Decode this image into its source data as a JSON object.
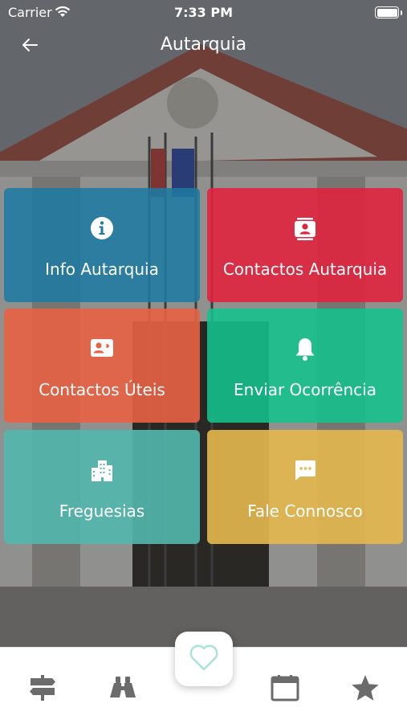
{
  "status_bar": {
    "carrier": "Carrier",
    "time": "7:33 PM"
  },
  "header": {
    "title": "Autarquia",
    "back_icon": "arrow-left-icon"
  },
  "tiles": [
    {
      "label": "Info Autarquia",
      "icon": "info-circle-icon",
      "color": "#1f7aa3"
    },
    {
      "label": "Contactos Autarquia",
      "icon": "contact-book-icon",
      "color": "#e0243e"
    },
    {
      "label": "Contactos Úteis",
      "icon": "contact-card-icon",
      "color": "#e86244"
    },
    {
      "label": "Enviar Ocorrência",
      "icon": "bell-icon",
      "color": "#13c18c"
    },
    {
      "label": "Freguesias",
      "icon": "buildings-icon",
      "color": "#52b7ad"
    },
    {
      "label": "Fale Connosco",
      "icon": "chat-bubble-icon",
      "color": "#e6b84e"
    }
  ],
  "tab_bar": {
    "tabs": [
      "signpost-icon",
      "binoculars-icon",
      "calendar-icon",
      "star-icon"
    ],
    "center": "heart-icon",
    "icon_color": "#6b6b6b",
    "center_icon_color": "#a9e3d5"
  }
}
